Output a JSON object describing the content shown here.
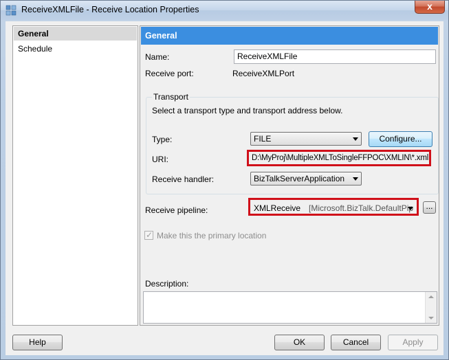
{
  "window": {
    "title": "ReceiveXMLFile - Receive Location Properties",
    "close_glyph": "x"
  },
  "nav": {
    "items": [
      {
        "label": "General",
        "selected": true
      },
      {
        "label": "Schedule",
        "selected": false
      }
    ]
  },
  "panel": {
    "header": "General",
    "name_label": "Name:",
    "name_value": "ReceiveXMLFile",
    "receive_port_label": "Receive port:",
    "receive_port_value": "ReceiveXMLPort",
    "transport": {
      "caption": "Transport",
      "description": "Select a transport type and transport address below.",
      "type_label": "Type:",
      "type_value": "FILE",
      "configure_label": "Configure...",
      "uri_label": "URI:",
      "uri_value": "D:\\MyProj\\MultipleXMLToSingleFFPOC\\XMLIN\\*.xml",
      "handler_label": "Receive handler:",
      "handler_value": "BizTalkServerApplication"
    },
    "pipeline_label": "Receive pipeline:",
    "pipeline_value": "XMLReceive",
    "pipeline_assembly": "[Microsoft.BizTalk.DefaultPip",
    "pipeline_browse": "...",
    "primary_location_label": "Make this the primary location",
    "primary_location_checked": true,
    "description_label": "Description:",
    "description_value": ""
  },
  "footer": {
    "help_label": "Help",
    "ok_label": "OK",
    "cancel_label": "Cancel",
    "apply_label": "Apply"
  },
  "colors": {
    "header_blue": "#3b8ee0",
    "highlight_red": "#d0101a"
  },
  "icons": {
    "window_icon": "biztalk-app-icon",
    "checkbox_mark": "✓"
  }
}
